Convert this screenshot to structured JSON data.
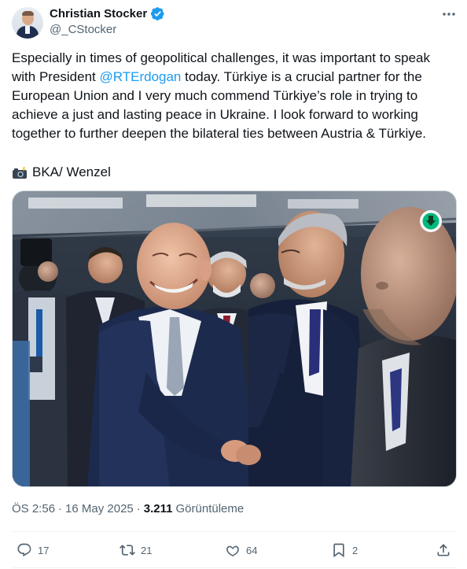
{
  "author": {
    "display_name": "Christian Stocker",
    "handle": "@_CStocker",
    "verified": true,
    "verified_color": "#1d9bf0"
  },
  "more_icon": "more-horizontal-icon",
  "tweet": {
    "lines": [
      "Especially in times of geopolitical challenges, it was important to speak",
      {
        "before": "with President ",
        "mention": "@RTErdogan",
        "after": " today. Türkiye is a crucial partner for the"
      },
      "European Union and I very much commend Türkiye’s role in trying to",
      "achieve a just and lasting peace in Ukraine. I look forward to working",
      "together to further deepen the bilateral ties between Austria & Türkiye."
    ],
    "mention_color": "#1d9bf0",
    "credit_icon": "camera-flash-icon",
    "credit_text": "BKA/ Wenzel"
  },
  "media": {
    "badge_icon": "download-arrow-icon",
    "badge_color": "#00ba7c"
  },
  "meta": {
    "time": "ÖS 2:56",
    "separator": "·",
    "date": "16 May 2025",
    "views_count": "3.211",
    "views_label": "Görüntüleme"
  },
  "actions": {
    "replies": "17",
    "reposts": "21",
    "likes": "64",
    "bookmarks": "2",
    "icons": [
      "reply-icon",
      "repost-icon",
      "like-icon",
      "bookmark-icon",
      "share-icon"
    ]
  }
}
